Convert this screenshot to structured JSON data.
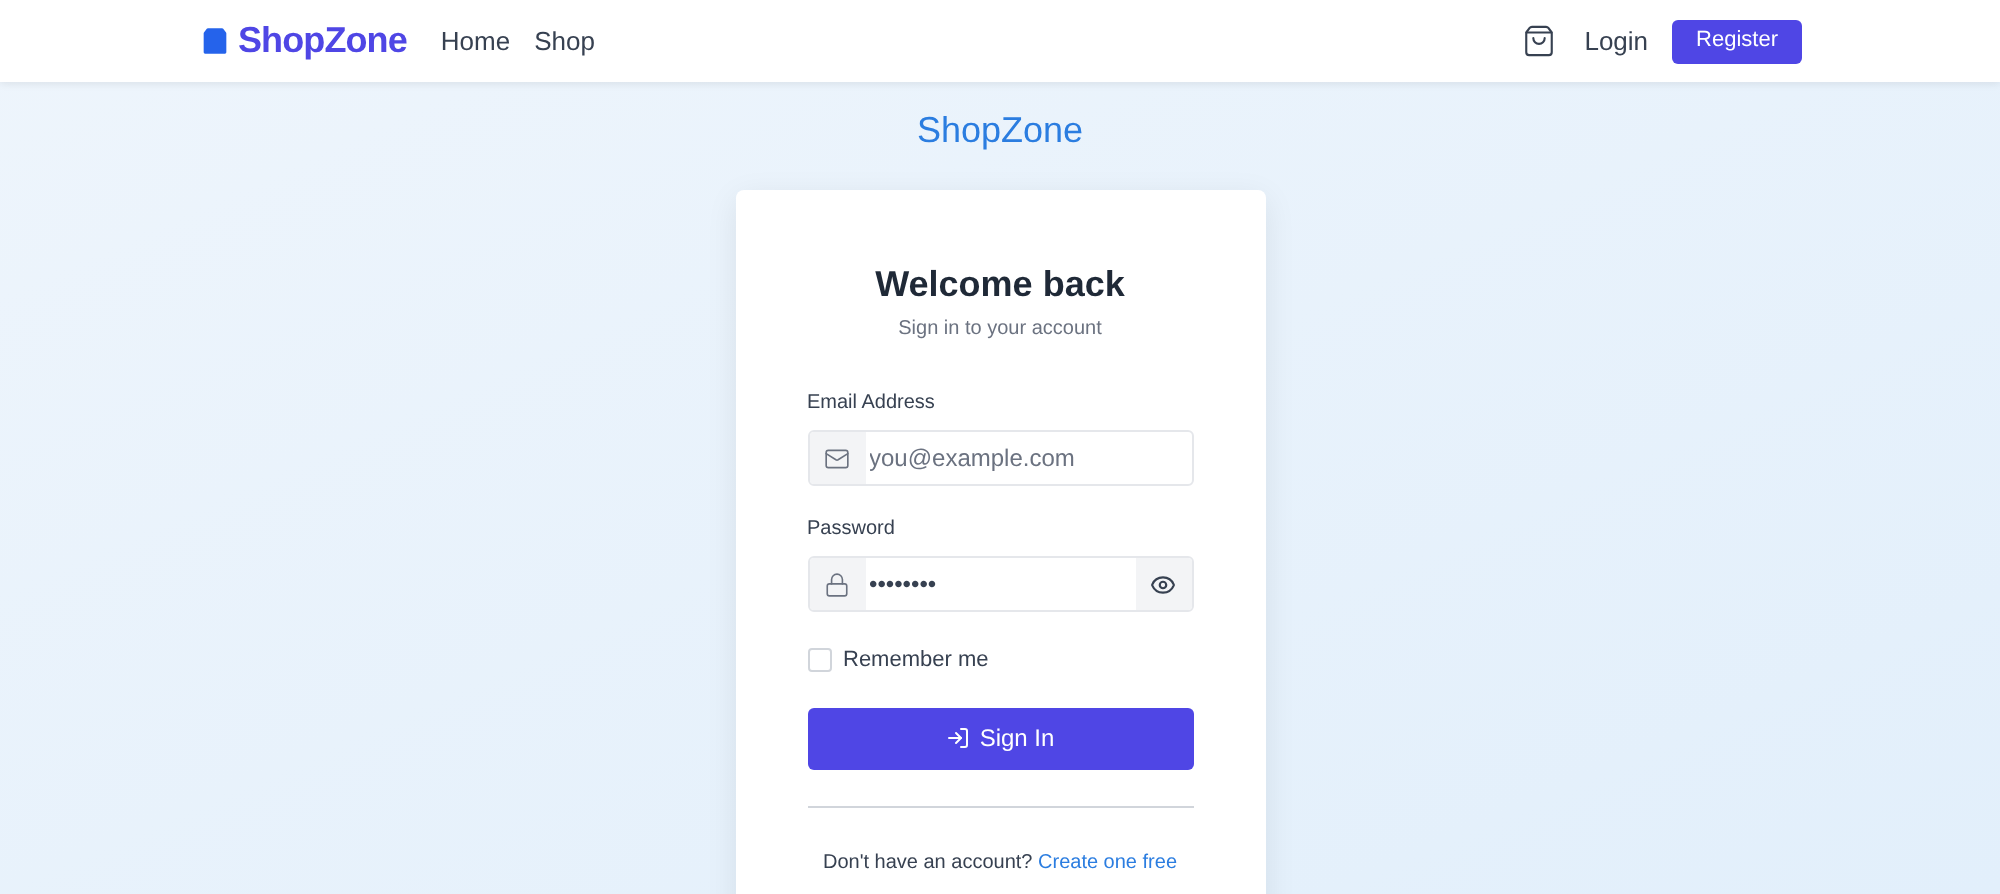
{
  "navbar": {
    "brand": "ShopZone",
    "links": [
      "Home",
      "Shop"
    ],
    "login": "Login",
    "register": "Register"
  },
  "site_title": "ShopZone",
  "card": {
    "title": "Welcome back",
    "subtitle": "Sign in to your account",
    "email": {
      "label": "Email Address",
      "placeholder": "you@example.com"
    },
    "password": {
      "label": "Password",
      "value": "••••••••"
    },
    "remember": {
      "label": "Remember me",
      "checked": false
    },
    "submit": "Sign In",
    "signup": {
      "text": "Don't have an account?",
      "link": "Create one free"
    }
  }
}
